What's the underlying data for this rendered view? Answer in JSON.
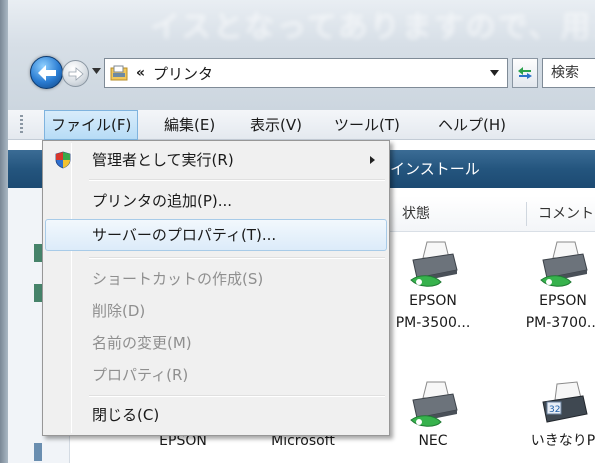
{
  "window": {
    "blurred_title": "イスとなってありますので、用紙サ"
  },
  "nav": {
    "address_separator": "«",
    "address_text": "プリンタ",
    "refresh_icon": "refresh-icon",
    "search_placeholder": "検索"
  },
  "menubar": {
    "items": [
      {
        "label": "ファイル(F)",
        "active": true
      },
      {
        "label": "編集(E)",
        "active": false
      },
      {
        "label": "表示(V)",
        "active": false
      },
      {
        "label": "ツール(T)",
        "active": false
      },
      {
        "label": "ヘルプ(H)",
        "active": false
      }
    ]
  },
  "toolbar": {
    "visible_text": "インストール"
  },
  "columns": {
    "status": "状態",
    "comment": "コメント"
  },
  "printers": [
    {
      "line1": "EPSON",
      "line2": "PM-3500..."
    },
    {
      "line1": "EPSON",
      "line2": "PM-3700..."
    },
    {
      "line1": "EPSON",
      "line2": ""
    },
    {
      "line1": "Microsoft",
      "line2": ""
    },
    {
      "line1": "NEC",
      "line2": ""
    },
    {
      "line1": "いきなりP",
      "line2": ""
    }
  ],
  "context_menu": {
    "items": [
      {
        "label": "管理者として実行(R)",
        "disabled": false,
        "submenu": true,
        "icon": "uac-shield-icon"
      },
      {
        "label": "プリンタの追加(P)...",
        "disabled": false
      },
      {
        "label": "サーバーのプロパティ(T)...",
        "disabled": false,
        "highlighted": true
      },
      {
        "label": "ショートカットの作成(S)",
        "disabled": true
      },
      {
        "label": "削除(D)",
        "disabled": true
      },
      {
        "label": "名前の変更(M)",
        "disabled": true
      },
      {
        "label": "プロパティ(R)",
        "disabled": true
      },
      {
        "label": "閉じる(C)",
        "disabled": false
      }
    ]
  },
  "colors": {
    "toolbar_band": "#24557e",
    "menu_highlight": "#dcebf9",
    "disabled_text": "#8f8f8f"
  }
}
